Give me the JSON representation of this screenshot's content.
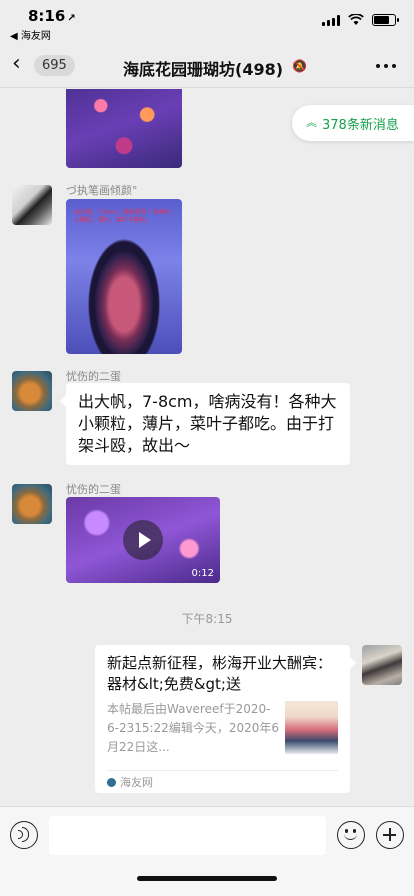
{
  "status_bar": {
    "time": "8:16",
    "location_arrow": "↗",
    "back_to_app": "◀ 海友网"
  },
  "nav": {
    "back_icon": "chevron-left",
    "unread_count": "695",
    "title": "海底花园珊瑚坊(498)",
    "mute_icon": "bell-slash",
    "more_icon": "ellipsis"
  },
  "new_messages_banner": {
    "text": "378条新消息",
    "color": "#15a04a"
  },
  "messages": [
    {
      "type": "image",
      "sender": ""
    },
    {
      "type": "image",
      "sender": "づ执笔画倾颜°",
      "overlay_text": "出大帆，7-8cm，啥病没有！各种大小颗粒，薄片，菜叶子都吃。"
    },
    {
      "type": "text",
      "sender": "忧伤的二蛋",
      "text": "出大帆，7-8cm，啥病没有！各种大小颗粒，薄片，菜叶子都吃。由于打架斗殴，故出～"
    },
    {
      "type": "video",
      "sender": "忧伤的二蛋",
      "duration": "0:12"
    }
  ],
  "timestamp": "下午8:15",
  "link_card": {
    "title": "新起点新征程，彬海开业大酬宾：器材&lt;免费&gt;送",
    "description": "本帖最后由Wavereef于2020-6-2315:22编辑今天，2020年6月22日这...",
    "source": "海友网"
  },
  "input_bar": {
    "voice_icon": "voice-icon",
    "emoji_icon": "emoji-icon",
    "plus_icon": "plus-icon",
    "text_value": ""
  }
}
